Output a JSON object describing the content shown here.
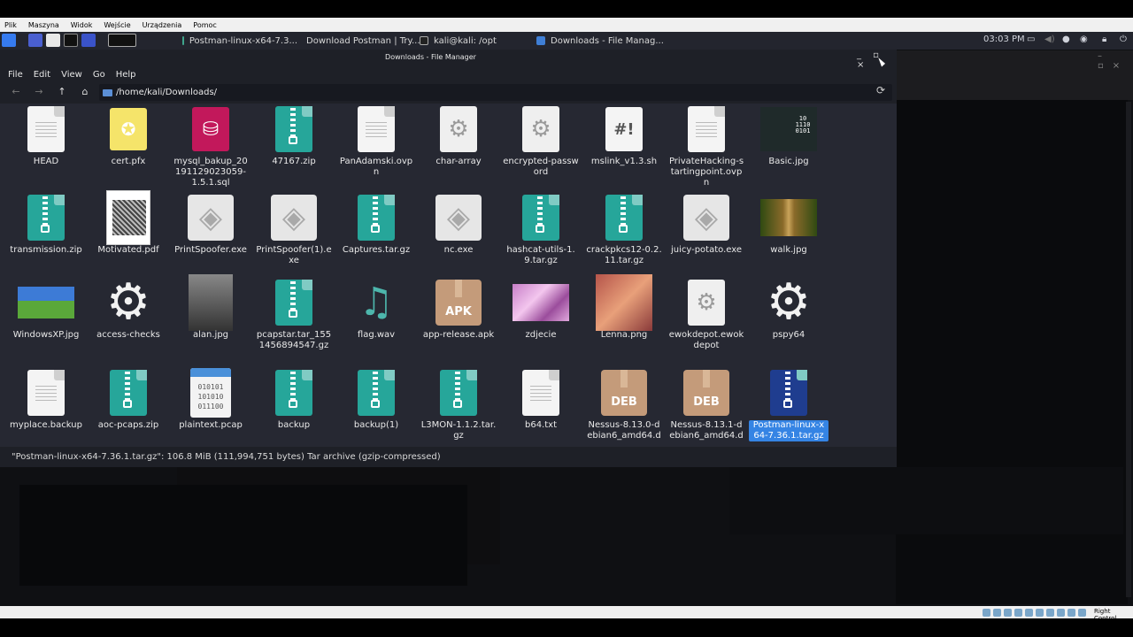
{
  "vbox_menu": [
    "Plik",
    "Maszyna",
    "Widok",
    "Wejście",
    "Urządzenia",
    "Pomoc"
  ],
  "taskbar": {
    "tasks": [
      {
        "label": "Postman-linux-x64-7.3...",
        "icon": "file-manager-icon"
      },
      {
        "label": "Download Postman | Try...",
        "icon": "firefox-icon"
      },
      {
        "label": "kali@kali: /opt",
        "icon": "terminal-icon"
      },
      {
        "label": "Downloads - File Manag...",
        "icon": "file-manager-icon"
      }
    ],
    "clock": "03:03 PM"
  },
  "window": {
    "title": "Downloads - File Manager",
    "controls": "_ ▫ ×"
  },
  "menubar": [
    "File",
    "Edit",
    "View",
    "Go",
    "Help"
  ],
  "location": "/home/kali/Downloads/",
  "files": [
    {
      "name": "HEAD",
      "type": "text"
    },
    {
      "name": "cert.pfx",
      "type": "cert"
    },
    {
      "name": "mysql_bakup_20191129023059-1.5.1.sql",
      "type": "sql"
    },
    {
      "name": "47167.zip",
      "type": "zip"
    },
    {
      "name": "PanAdamski.ovpn",
      "type": "text"
    },
    {
      "name": "char-array",
      "type": "gear"
    },
    {
      "name": "encrypted-password",
      "type": "gear"
    },
    {
      "name": "mslink_v1.3.sh",
      "type": "script"
    },
    {
      "name": "PrivateHacking-startingpoint.ovpn",
      "type": "text"
    },
    {
      "name": "Basic.jpg",
      "type": "image-binary"
    },
    {
      "name": "transmission.zip",
      "type": "zip"
    },
    {
      "name": "Motivated.pdf",
      "type": "pdf"
    },
    {
      "name": "PrintSpoofer.exe",
      "type": "exe"
    },
    {
      "name": "PrintSpoofer(1).exe",
      "type": "exe"
    },
    {
      "name": "Captures.tar.gz",
      "type": "zip"
    },
    {
      "name": "nc.exe",
      "type": "exe"
    },
    {
      "name": "hashcat-utils-1.9.tar.gz",
      "type": "zip"
    },
    {
      "name": "crackpkcs12-0.2.11.tar.gz",
      "type": "zip"
    },
    {
      "name": "juicy-potato.exe",
      "type": "exe"
    },
    {
      "name": "walk.jpg",
      "type": "image-walk"
    },
    {
      "name": "WindowsXP.jpg",
      "type": "image-xp"
    },
    {
      "name": "access-checks",
      "type": "gearbig"
    },
    {
      "name": "alan.jpg",
      "type": "image-portrait"
    },
    {
      "name": "pcapstar.tar_1551456894547.gz",
      "type": "zip"
    },
    {
      "name": "flag.wav",
      "type": "audio"
    },
    {
      "name": "app-release.apk",
      "type": "apk"
    },
    {
      "name": "zdjecie",
      "type": "image-pink"
    },
    {
      "name": "Lenna.png",
      "type": "image-lenna"
    },
    {
      "name": "ewokdepot.ewokdepot",
      "type": "gear"
    },
    {
      "name": "pspy64",
      "type": "gearbig"
    },
    {
      "name": "myplace.backup",
      "type": "text"
    },
    {
      "name": "aoc-pcaps.zip",
      "type": "zip"
    },
    {
      "name": "plaintext.pcap",
      "type": "pcap"
    },
    {
      "name": "backup",
      "type": "zip"
    },
    {
      "name": "backup(1)",
      "type": "zip"
    },
    {
      "name": "L3MON-1.1.2.tar.gz",
      "type": "zip"
    },
    {
      "name": "b64.txt",
      "type": "text"
    },
    {
      "name": "Nessus-8.13.0-debian6_amd64.d",
      "type": "deb"
    },
    {
      "name": "Nessus-8.13.1-debian6_amd64.d",
      "type": "deb"
    },
    {
      "name": "Postman-linux-x64-7.36.1.tar.gz",
      "type": "zip-blue",
      "selected": true
    }
  ],
  "icon_labels": {
    "apk": "APK",
    "deb": "DEB",
    "script": "#!",
    "pcap": [
      "010101",
      "101010",
      "011100"
    ]
  },
  "status": "\"Postman-linux-x64-7.36.1.tar.gz\": 106.8 MiB (111,994,751 bytes) Tar archive (gzip-compressed)",
  "host_key": "Right Control",
  "colors": {
    "accent": "#3584e4",
    "zip": "#26a69a",
    "deb": "#c49b7a"
  }
}
